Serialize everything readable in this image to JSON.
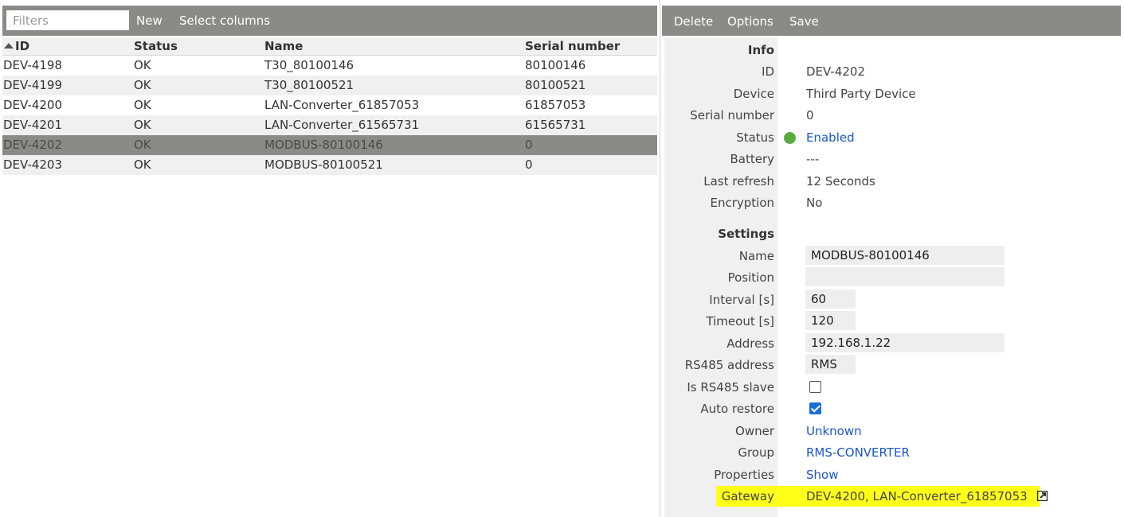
{
  "list": {
    "filter_placeholder": "Filters",
    "toolbar": {
      "new_label": "New",
      "select_columns_label": "Select columns"
    },
    "columns": {
      "id": "ID",
      "status": "Status",
      "name": "Name",
      "serial": "Serial number"
    },
    "rows": [
      {
        "id": "DEV-4198",
        "status": "OK",
        "name": "T30_80100146",
        "serial": "80100146"
      },
      {
        "id": "DEV-4199",
        "status": "OK",
        "name": "T30_80100521",
        "serial": "80100521"
      },
      {
        "id": "DEV-4200",
        "status": "OK",
        "name": "LAN-Converter_61857053",
        "serial": "61857053"
      },
      {
        "id": "DEV-4201",
        "status": "OK",
        "name": "LAN-Converter_61565731",
        "serial": "61565731"
      },
      {
        "id": "DEV-4202",
        "status": "OK",
        "name": "MODBUS-80100146",
        "serial": "0"
      },
      {
        "id": "DEV-4203",
        "status": "OK",
        "name": "MODBUS-80100521",
        "serial": "0"
      }
    ],
    "selected_row": "DEV-4202"
  },
  "detail": {
    "toolbar": {
      "delete_label": "Delete",
      "options_label": "Options",
      "save_label": "Save"
    },
    "info": {
      "header": "Info",
      "id_label": "ID",
      "id_value": "DEV-4202",
      "device_label": "Device",
      "device_value": "Third Party Device",
      "serial_label": "Serial number",
      "serial_value": "0",
      "status_label": "Status",
      "status_value": "Enabled",
      "status_color": "#5aab3e",
      "battery_label": "Battery",
      "battery_value": "---",
      "refresh_label": "Last refresh",
      "refresh_value": "12 Seconds",
      "encryption_label": "Encryption",
      "encryption_value": "No"
    },
    "settings": {
      "header": "Settings",
      "name_label": "Name",
      "name_value": "MODBUS-80100146",
      "position_label": "Position",
      "position_value": "",
      "interval_label": "Interval [s]",
      "interval_value": "60",
      "timeout_label": "Timeout [s]",
      "timeout_value": "120",
      "address_label": "Address",
      "address_value": "192.168.1.22",
      "rs485_label": "RS485 address",
      "rs485_value": "RMS",
      "is_slave_label": "Is RS485 slave",
      "is_slave_checked": false,
      "auto_restore_label": "Auto restore",
      "auto_restore_checked": true,
      "owner_label": "Owner",
      "owner_value": "Unknown",
      "group_label": "Group",
      "group_value": "RMS-CONVERTER",
      "properties_label": "Properties",
      "properties_value": "Show",
      "gateway_label": "Gateway",
      "gateway_value": "DEV-4200, LAN-Converter_61857053",
      "highlight_color": "#ffff1a"
    }
  },
  "colors": {
    "toolbar_bg": "#8a8a86",
    "link": "#1a56c9",
    "checkbox_accent": "#1a6fd6"
  }
}
